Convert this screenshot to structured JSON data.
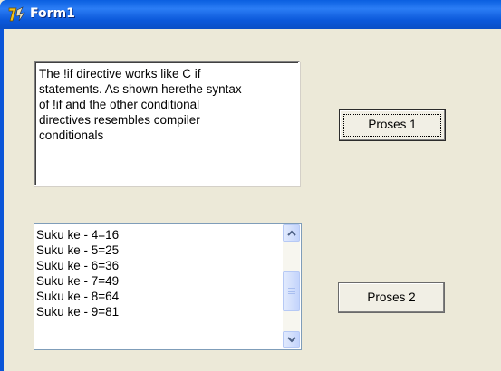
{
  "window": {
    "title": "Form1",
    "icon": "delphi-app-icon"
  },
  "memo": {
    "lines": [
      "The !if directive works like C if",
      "statements. As shown herethe syntax",
      "of !if and the other conditional",
      "directives resembles compiler",
      "conditionals"
    ]
  },
  "listbox": {
    "items": [
      "Suku ke - 4=16",
      "Suku ke - 5=25",
      "Suku ke - 6=36",
      "Suku ke - 7=49",
      "Suku ke - 8=64",
      "Suku ke - 9=81"
    ],
    "scroll_up_icon": "chevron-up-icon",
    "scroll_down_icon": "chevron-down-icon"
  },
  "buttons": {
    "proses1_label": "Proses 1",
    "proses2_label": "Proses 2"
  },
  "colors": {
    "titlebar": "#0a5fe0",
    "form_background": "#ece9d8"
  }
}
